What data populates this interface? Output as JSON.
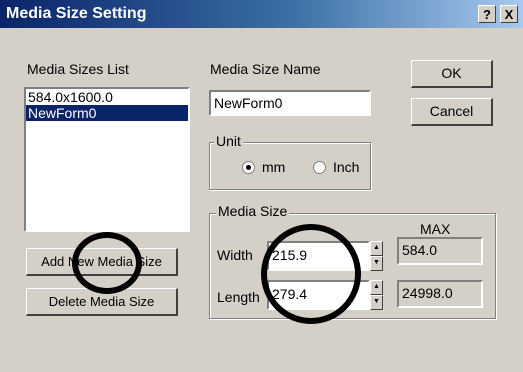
{
  "window": {
    "title": "Media Size Setting",
    "help_btn": "?",
    "close_btn": "X"
  },
  "list": {
    "label": "Media Sizes List",
    "items": [
      "584.0x1600.0",
      "NewForm0"
    ]
  },
  "name": {
    "label": "Media Size Name",
    "value": "NewForm0"
  },
  "buttons": {
    "ok": "OK",
    "cancel": "Cancel",
    "add": "Add New Media Size",
    "delete": "Delete Media Size"
  },
  "unit": {
    "label": "Unit",
    "mm": "mm",
    "inch": "Inch",
    "selected": "mm"
  },
  "size": {
    "label": "Media Size",
    "max_label": "MAX",
    "width_label": "Width",
    "width_value": "215.9",
    "width_max": "584.0",
    "length_label": "Length",
    "length_value": "279.4",
    "length_max": "24998.0"
  }
}
